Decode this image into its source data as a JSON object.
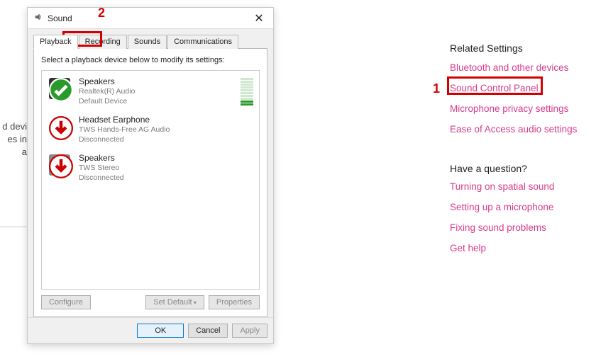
{
  "dialog": {
    "title": "Sound",
    "tabs": [
      "Playback",
      "Recording",
      "Sounds",
      "Communications"
    ],
    "active_tab": 0,
    "instruction": "Select a playback device below to modify its settings:",
    "devices": [
      {
        "name": "Speakers",
        "line2": "Realtek(R) Audio",
        "line3": "Default Device",
        "status": "default",
        "meter": true
      },
      {
        "name": "Headset Earphone",
        "line2": "TWS Hands-Free AG Audio",
        "line3": "Disconnected",
        "status": "disconnected",
        "meter": false
      },
      {
        "name": "Speakers",
        "line2": "TWS Stereo",
        "line3": "Disconnected",
        "status": "disconnected",
        "meter": false
      }
    ],
    "buttons": {
      "configure": "Configure",
      "set_default": "Set Default",
      "properties": "Properties",
      "ok": "OK",
      "cancel": "Cancel",
      "apply": "Apply"
    }
  },
  "sidebar": {
    "related_heading": "Related Settings",
    "links": [
      "Bluetooth and other devices",
      "Sound Control Panel",
      "Microphone privacy settings",
      "Ease of Access audio settings"
    ],
    "question_heading": "Have a question?",
    "help_links": [
      "Turning on spatial sound",
      "Setting up a microphone",
      "Fixing sound problems",
      "Get help"
    ]
  },
  "background": {
    "line1": "d devi",
    "line2": "es in a"
  },
  "callouts": [
    {
      "num": "1",
      "target": "sound-control-panel"
    },
    {
      "num": "2",
      "target": "tab-recording"
    }
  ]
}
